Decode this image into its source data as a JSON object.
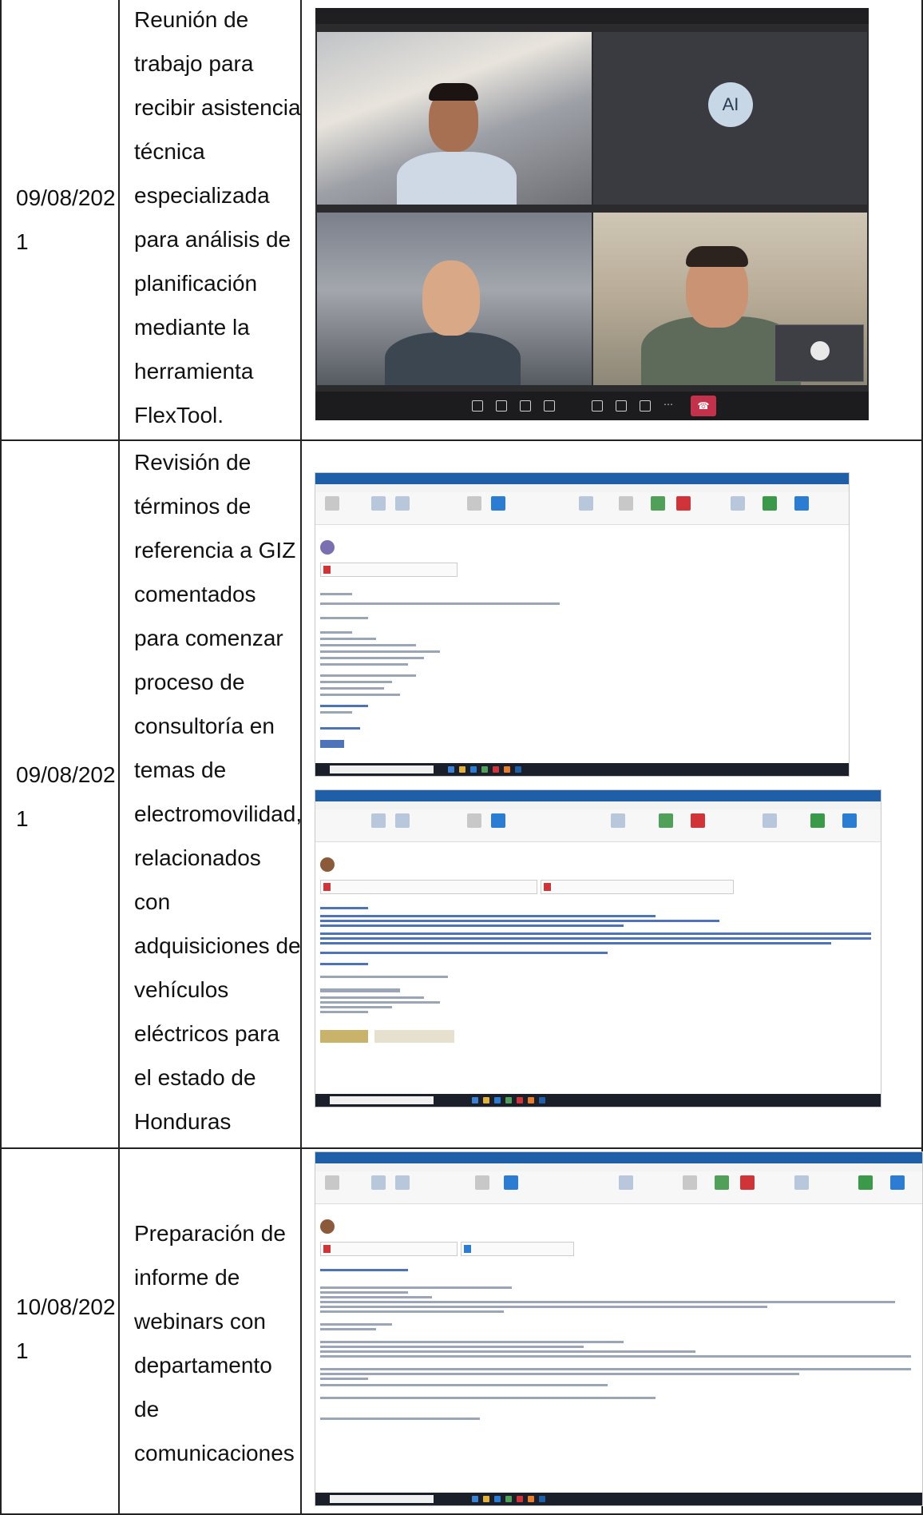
{
  "rows": [
    {
      "date_lines": [
        "09/08/202",
        "1"
      ],
      "desc_lines": [
        "Reunión de",
        "trabajo para",
        "recibir asistencia",
        "técnica",
        "especializada",
        "para análisis de",
        "planificación",
        "mediante la",
        "herramienta",
        "FlexTool."
      ]
    },
    {
      "date_lines": [
        "09/08/202",
        "1"
      ],
      "desc_lines": [
        "Revisión de",
        "términos de",
        "referencia a GIZ",
        "comentados",
        "para comenzar",
        "proceso de",
        "consultoría en",
        "temas de",
        "electromovilidad,",
        "relacionados",
        "con",
        "adquisiciones de",
        "vehículos",
        "eléctricos para",
        "el estado de",
        "Honduras"
      ]
    },
    {
      "date_lines": [
        "10/08/202",
        "1"
      ],
      "desc_lines": [
        "Preparación de",
        "informe de",
        "webinars con",
        "departamento",
        "de",
        "comunicaciones"
      ]
    }
  ],
  "video_call": {
    "avatar_initials": "AI"
  }
}
